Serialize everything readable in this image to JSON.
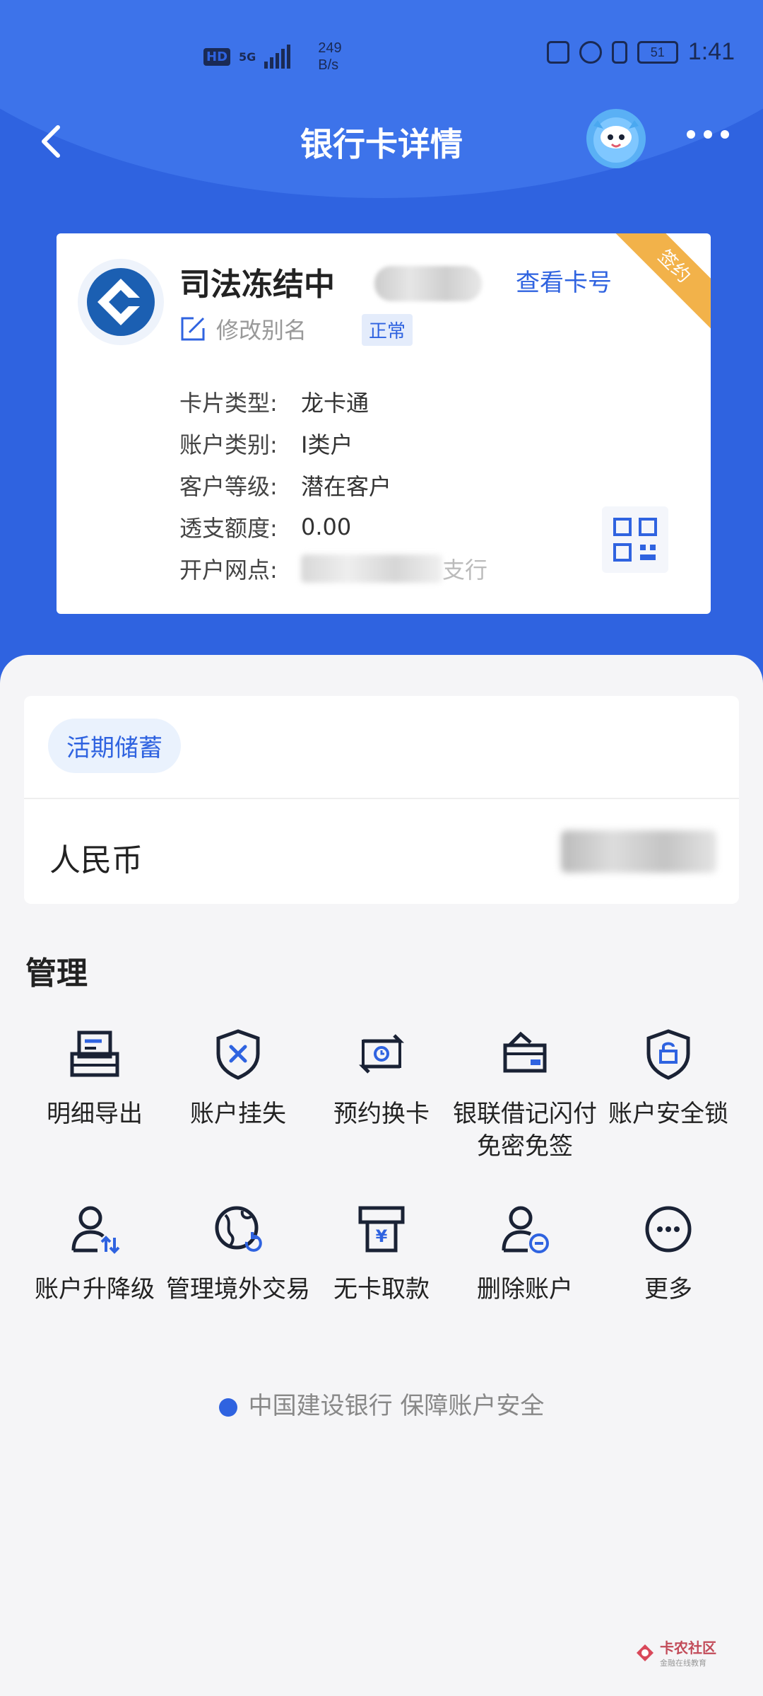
{
  "status_bar": {
    "network": "5G",
    "speed_value": "249",
    "speed_unit": "B/s",
    "battery": "51",
    "time": "1:41"
  },
  "nav": {
    "title": "银行卡详情"
  },
  "card": {
    "ribbon": "签约",
    "name": "司法冻结中",
    "view_card_no": "查看卡号",
    "alias_label": "修改别名",
    "status_badge": "正常",
    "rows": [
      {
        "key": "卡片类型:",
        "value": "龙卡通"
      },
      {
        "key": "账户类别:",
        "value": "I类户"
      },
      {
        "key": "客户等级:",
        "value": "潜在客户"
      },
      {
        "key": "透支额度:",
        "value": "0.00"
      },
      {
        "key": "开户网点:",
        "value": "支行"
      }
    ]
  },
  "account": {
    "type_pill": "活期储蓄",
    "currency": "人民币"
  },
  "manage": {
    "title": "管理",
    "items": [
      {
        "label": "明细导出",
        "icon": "export-detail-icon"
      },
      {
        "label": "账户挂失",
        "icon": "shield-x-icon"
      },
      {
        "label": "预约换卡",
        "icon": "card-swap-icon"
      },
      {
        "label": "银联借记闪付免密免签",
        "icon": "card-hand-icon"
      },
      {
        "label": "账户安全锁",
        "icon": "shield-lock-icon"
      },
      {
        "label": "账户升降级",
        "icon": "user-updown-icon"
      },
      {
        "label": "管理境外交易",
        "icon": "globe-refresh-icon"
      },
      {
        "label": "无卡取款",
        "icon": "atm-icon"
      },
      {
        "label": "删除账户",
        "icon": "user-remove-icon"
      },
      {
        "label": "更多",
        "icon": "more-circle-icon"
      }
    ]
  },
  "footer": {
    "text": "中国建设银行 保障账户安全"
  },
  "watermark": {
    "title": "卡农社区",
    "subtitle": "金融在线教育"
  },
  "colors": {
    "primary": "#2f63e0",
    "ribbon": "#f2b24a",
    "bg": "#f5f5f7",
    "icon_dark": "#1a2235"
  }
}
